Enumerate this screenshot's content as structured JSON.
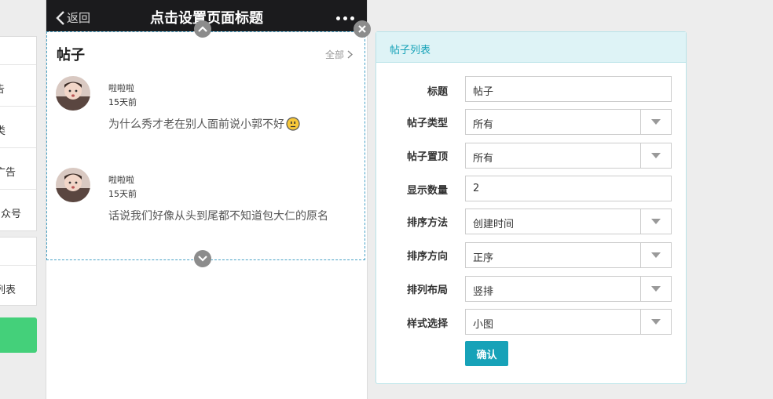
{
  "left_menu": {
    "group1": [
      "",
      "告",
      "类",
      "广告",
      "众号"
    ],
    "group2": [
      "",
      "列表"
    ]
  },
  "phone": {
    "back_label": "返回",
    "page_title": "点击设置页面标题",
    "module": {
      "title": "帖子",
      "all_label": "全部",
      "posts": [
        {
          "name": "啦啦啦",
          "time": "15天前",
          "content": "为什么秀才老在别人面前说小郭不好",
          "emoji": "smiley-emoji"
        },
        {
          "name": "啦啦啦",
          "time": "15天前",
          "content": "话说我们好像从头到尾都不知道包大仁的原名"
        }
      ]
    }
  },
  "panel": {
    "title": "帖子列表",
    "fields": [
      {
        "label": "标题",
        "value": "帖子",
        "type": "text"
      },
      {
        "label": "帖子类型",
        "value": "所有",
        "type": "select"
      },
      {
        "label": "帖子置顶",
        "value": "所有",
        "type": "select"
      },
      {
        "label": "显示数量",
        "value": "2",
        "type": "text"
      },
      {
        "label": "排序方法",
        "value": "创建时间",
        "type": "select"
      },
      {
        "label": "排序方向",
        "value": "正序",
        "type": "select"
      },
      {
        "label": "排列布局",
        "value": "竖排",
        "type": "select"
      },
      {
        "label": "样式选择",
        "value": "小图",
        "type": "select"
      }
    ],
    "confirm_label": "确认"
  },
  "colors": {
    "topbar": "#1b1b1d",
    "accent": "#17a2b8",
    "panel_header": "#def3f6",
    "green_button": "#44d07a",
    "selection_border": "#4aa2c6"
  }
}
